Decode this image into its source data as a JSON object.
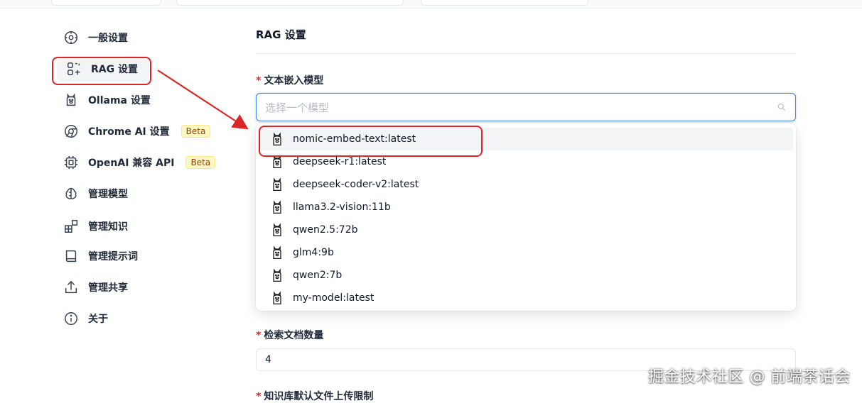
{
  "sidebar": {
    "items": [
      {
        "label": "一般设置",
        "icon": "settings-cog-icon"
      },
      {
        "label": "RAG 设置",
        "icon": "rag-blocks-icon",
        "active": true
      },
      {
        "label": "Ollama 设置",
        "icon": "llama-icon"
      },
      {
        "label": "Chrome AI 设置",
        "icon": "chrome-icon",
        "badge": "Beta"
      },
      {
        "label": "OpenAI 兼容 API",
        "icon": "chip-icon",
        "badge": "Beta"
      },
      {
        "label": "管理模型",
        "icon": "brain-icon"
      },
      {
        "label": "管理知识",
        "icon": "blocks-icon"
      },
      {
        "label": "管理提示词",
        "icon": "book-icon"
      },
      {
        "label": "管理共享",
        "icon": "share-icon"
      },
      {
        "label": "关于",
        "icon": "info-icon"
      }
    ]
  },
  "main": {
    "title": "RAG 设置",
    "embedding_field": {
      "required_mark": "*",
      "label": "文本嵌入模型",
      "placeholder": "选择一个模型",
      "options": [
        "nomic-embed-text:latest",
        "deepseek-r1:latest",
        "deepseek-coder-v2:latest",
        "llama3.2-vision:11b",
        "qwen2.5:72b",
        "glm4:9b",
        "qwen2:7b",
        "my-model:latest"
      ]
    },
    "doc_count_field": {
      "required_mark": "*",
      "label": "检索文档数量",
      "value": "4"
    },
    "upload_limit_field": {
      "required_mark": "*",
      "label": "知识库默认文件上传限制"
    }
  },
  "annotation_color": "#dc2626",
  "watermark": "掘金技术社区 @ 前端茶话会"
}
